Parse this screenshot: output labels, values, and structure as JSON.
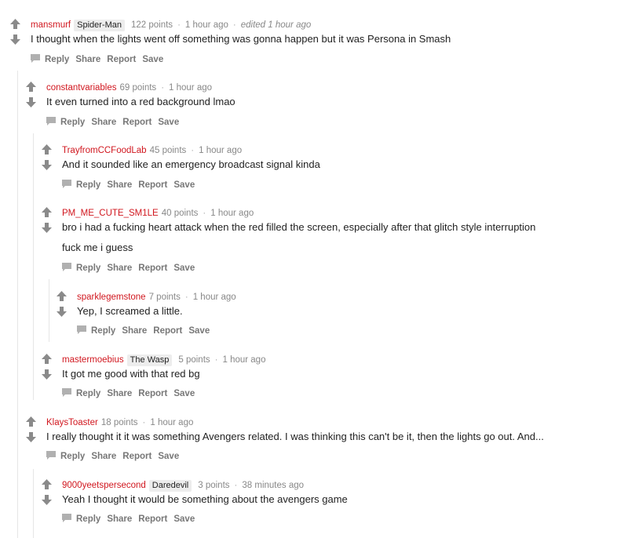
{
  "colors": {
    "author": "#d1171f",
    "meta": "#888888",
    "action": "#777777",
    "flair_bg": "#ededed"
  },
  "icons": {
    "upvote": "upvote-arrow-icon",
    "downvote": "downvote-arrow-icon",
    "reply": "reply-speech-icon"
  },
  "actions": {
    "reply": "Reply",
    "share": "Share",
    "report": "Report",
    "save": "Save"
  },
  "comments": [
    {
      "author": "mansmurf",
      "flair": "Spider-Man",
      "points": "122 points",
      "time": "1 hour ago",
      "edited": "edited 1 hour ago",
      "body": [
        "I thought when the lights went off something was gonna happen but it was Persona in Smash"
      ]
    },
    {
      "author": "constantvariables",
      "flair": "",
      "points": "69 points",
      "time": "1 hour ago",
      "edited": "",
      "body": [
        "It even turned into a red background lmao"
      ]
    },
    {
      "author": "TrayfromCCFoodLab",
      "flair": "",
      "points": "45 points",
      "time": "1 hour ago",
      "edited": "",
      "body": [
        "And it sounded like an emergency broadcast signal kinda"
      ]
    },
    {
      "author": "PM_ME_CUTE_SM1LE",
      "flair": "",
      "points": "40 points",
      "time": "1 hour ago",
      "edited": "",
      "body": [
        "bro i had a fucking heart attack when the red filled the screen, especially after that glitch style interruption",
        "fuck me i guess"
      ]
    },
    {
      "author": "sparklegemstone",
      "flair": "",
      "points": "7 points",
      "time": "1 hour ago",
      "edited": "",
      "body": [
        "Yep, I screamed a little."
      ]
    },
    {
      "author": "mastermoebius",
      "flair": "The Wasp",
      "points": "5 points",
      "time": "1 hour ago",
      "edited": "",
      "body": [
        "It got me good with that red bg"
      ]
    },
    {
      "author": "KlaysToaster",
      "flair": "",
      "points": "18 points",
      "time": "1 hour ago",
      "edited": "",
      "body": [
        "I really thought it it was something Avengers related. I was thinking this can't be it, then the lights go out. And..."
      ]
    },
    {
      "author": "9000yeetspersecond",
      "flair": "Daredevil",
      "points": "3 points",
      "time": "38 minutes ago",
      "edited": "",
      "body": [
        "Yeah I thought it would be something about the avengers game"
      ]
    }
  ]
}
